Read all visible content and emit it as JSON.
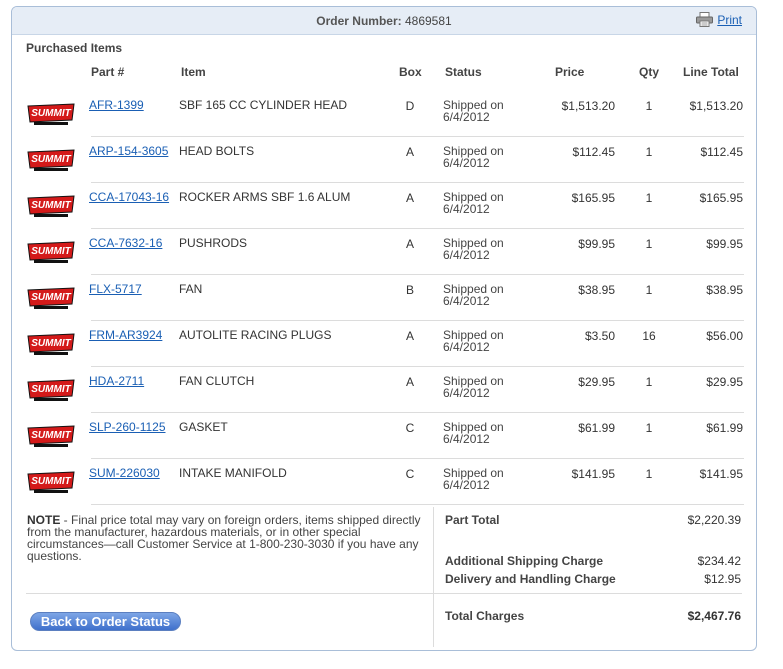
{
  "header": {
    "order_number_label": "Order Number:",
    "order_number": "4869581",
    "print_label": "Print"
  },
  "section_title": "Purchased Items",
  "columns": {
    "part": "Part #",
    "item": "Item",
    "box": "Box",
    "status": "Status",
    "price": "Price",
    "qty": "Qty",
    "line_total": "Line Total"
  },
  "logo_icon": "summit-racing-logo",
  "items": [
    {
      "part": "AFR-1399",
      "item": "SBF 165 CC CYLINDER HEAD",
      "box": "D",
      "status_1": "Shipped on",
      "status_2": "6/4/2012",
      "price": "$1,513.20",
      "qty": "1",
      "total": "$1,513.20"
    },
    {
      "part": "ARP-154-3605",
      "item": "HEAD BOLTS",
      "box": "A",
      "status_1": "Shipped on",
      "status_2": "6/4/2012",
      "price": "$112.45",
      "qty": "1",
      "total": "$112.45"
    },
    {
      "part": "CCA-17043-16",
      "item": "ROCKER ARMS SBF 1.6 ALUM",
      "box": "A",
      "status_1": "Shipped on",
      "status_2": "6/4/2012",
      "price": "$165.95",
      "qty": "1",
      "total": "$165.95"
    },
    {
      "part": "CCA-7632-16",
      "item": "PUSHRODS",
      "box": "A",
      "status_1": "Shipped on",
      "status_2": "6/4/2012",
      "price": "$99.95",
      "qty": "1",
      "total": "$99.95"
    },
    {
      "part": "FLX-5717",
      "item": "FAN",
      "box": "B",
      "status_1": "Shipped on",
      "status_2": "6/4/2012",
      "price": "$38.95",
      "qty": "1",
      "total": "$38.95"
    },
    {
      "part": "FRM-AR3924",
      "item": "AUTOLITE RACING PLUGS",
      "box": "A",
      "status_1": "Shipped on",
      "status_2": "6/4/2012",
      "price": "$3.50",
      "qty": "16",
      "total": "$56.00"
    },
    {
      "part": "HDA-2711",
      "item": "FAN CLUTCH",
      "box": "A",
      "status_1": "Shipped on",
      "status_2": "6/4/2012",
      "price": "$29.95",
      "qty": "1",
      "total": "$29.95"
    },
    {
      "part": "SLP-260-1125",
      "item": "GASKET",
      "box": "C",
      "status_1": "Shipped on",
      "status_2": "6/4/2012",
      "price": "$61.99",
      "qty": "1",
      "total": "$61.99"
    },
    {
      "part": "SUM-226030",
      "item": "INTAKE MANIFOLD",
      "box": "C",
      "status_1": "Shipped on",
      "status_2": "6/4/2012",
      "price": "$141.95",
      "qty": "1",
      "total": "$141.95"
    }
  ],
  "note": {
    "label": "NOTE",
    "text": " - Final price total may vary on foreign orders, items shipped directly from the manufacturer, hazardous materials, or in other special circumstances—call Customer Service at 1-800-230-3030 if you have any questions."
  },
  "summary": {
    "part_total_label": "Part Total",
    "part_total": "$2,220.39",
    "shipping_label": "Additional Shipping Charge",
    "shipping": "$234.42",
    "handling_label": "Delivery and Handling Charge",
    "handling": "$12.95",
    "total_label": "Total Charges",
    "total": "$2,467.76"
  },
  "back_button": "Back to Order Status",
  "colors": {
    "link": "#1a5fb4",
    "header_bg": "#e6edf6",
    "border": "#a9bed8",
    "button": "#3f70cc",
    "logo_red": "#d41a1a"
  }
}
